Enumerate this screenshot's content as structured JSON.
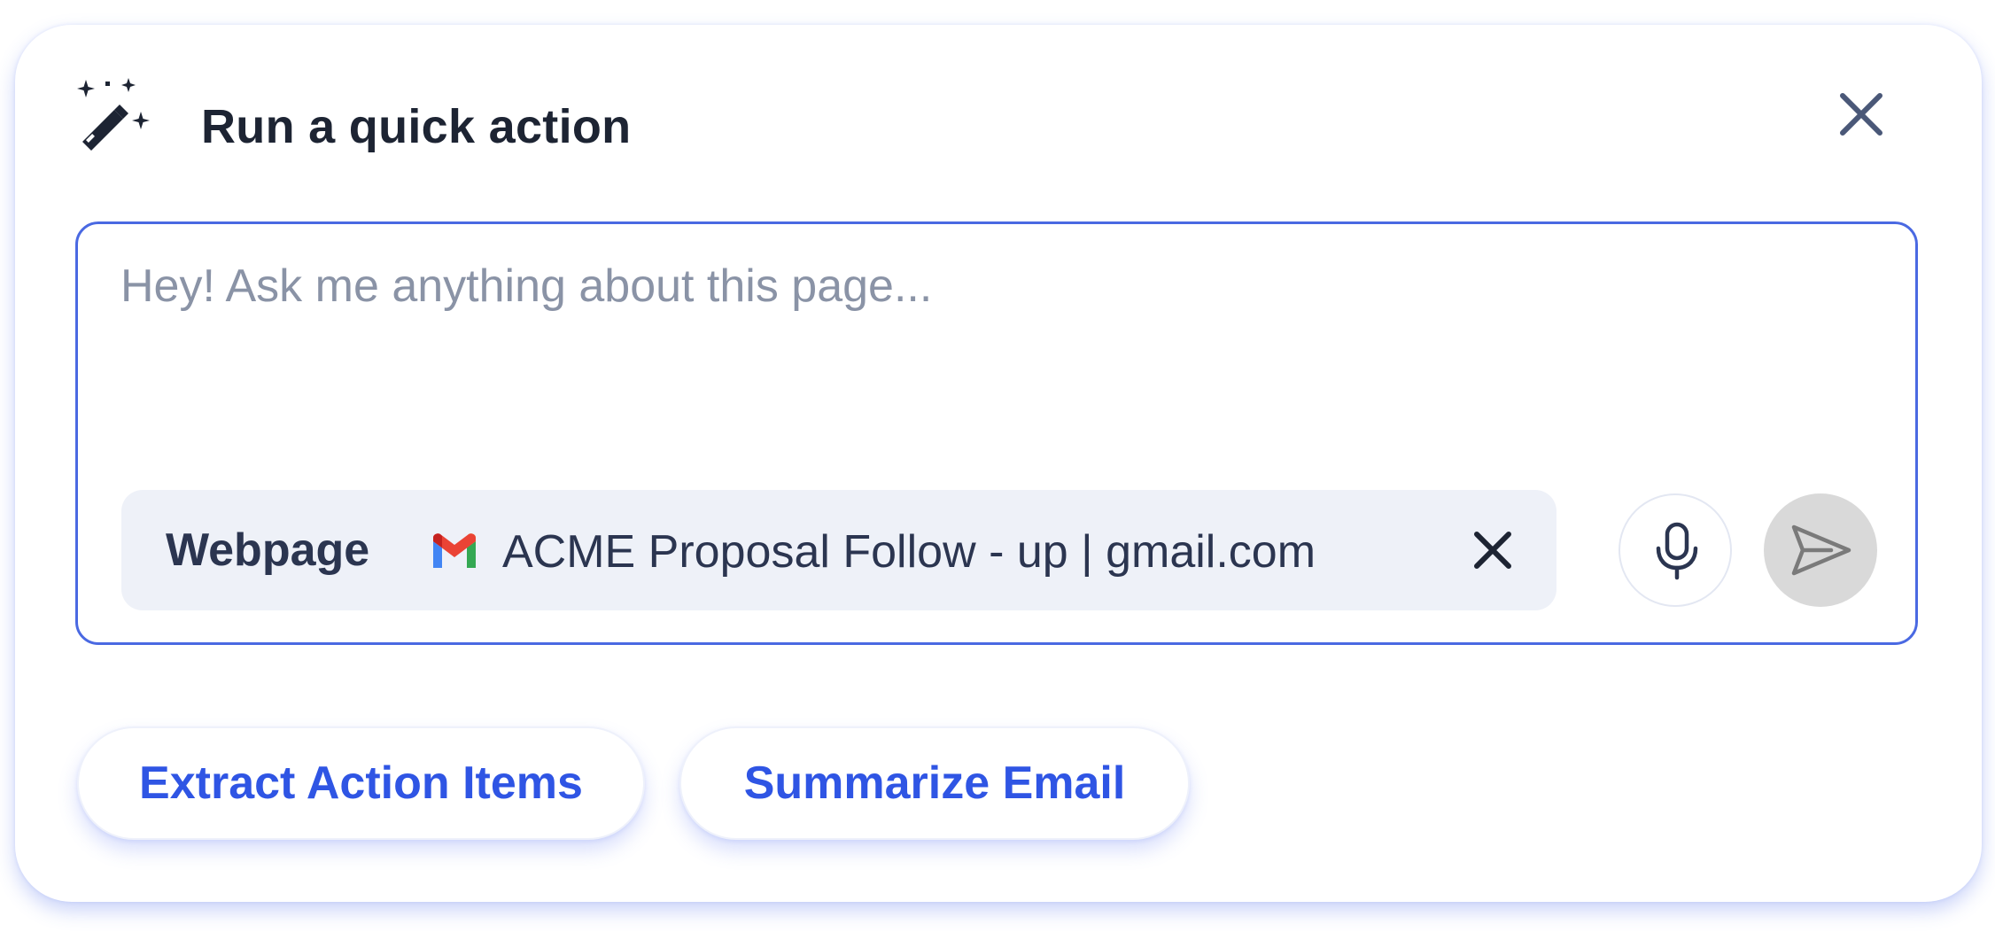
{
  "header": {
    "title": "Run a quick action",
    "icon": "magic-wand-sparkles-icon",
    "close_icon": "close-icon"
  },
  "prompt": {
    "placeholder": "Hey! Ask me anything about this page...",
    "value": ""
  },
  "context": {
    "label": "Webpage",
    "page_icon": "gmail-icon",
    "page_title": "ACME Proposal Follow - up | gmail.com",
    "remove_icon": "close-icon"
  },
  "actions": {
    "mic_icon": "microphone-icon",
    "send_icon": "send-icon"
  },
  "suggestions": [
    {
      "label": "Extract Action Items"
    },
    {
      "label": "Summarize Email"
    }
  ],
  "colors": {
    "accent": "#2f55e4",
    "input_border": "#4a69e2",
    "title_text": "#1d2433",
    "chip_background": "#eef1f8",
    "send_disabled": "#d9d9d9"
  }
}
